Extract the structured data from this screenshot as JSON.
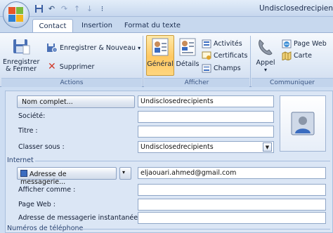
{
  "window": {
    "title": "Undisclosedrecipients"
  },
  "quick_access": {
    "icons": [
      "save-icon",
      "undo-icon",
      "redo-icon",
      "up-arrow-icon",
      "down-arrow-icon",
      "customize-icon"
    ]
  },
  "tabs": [
    {
      "label": "Contact",
      "active": true
    },
    {
      "label": "Insertion",
      "active": false
    },
    {
      "label": "Format du texte",
      "active": false
    }
  ],
  "ribbon": {
    "actions": {
      "label": "Actions",
      "save_close_line1": "Enregistrer",
      "save_close_line2": "& Fermer",
      "save_new": "Enregistrer & Nouveau",
      "save_new_caret": "▾",
      "delete": "Supprimer"
    },
    "afficher": {
      "label": "Afficher",
      "general": "Général",
      "details": "Détails",
      "activities": "Activités",
      "certificates": "Certificats",
      "fields": "Champs"
    },
    "communiquer": {
      "label": "Communiquer",
      "call": "Appel",
      "call_caret": "▾",
      "web_page": "Page Web",
      "map": "Carte"
    }
  },
  "form": {
    "full_name_button": "Nom complet...",
    "full_name_value": "Undisclosedrecipients",
    "company_label": "Société:",
    "company_value": "",
    "title_label": "Titre :",
    "title_value": "",
    "file_as_label": "Classer sous :",
    "file_as_value": "Undisclosedrecipients",
    "internet_section": "Internet",
    "email_button": "Adresse de messagerie...",
    "email_value": "eljaouari.ahmed@gmail.com",
    "display_as_label": "Afficher comme :",
    "display_as_value": "",
    "web_page_label": "Page Web :",
    "web_page_value": "",
    "im_label": "Adresse de messagerie instantanée :",
    "im_value": "",
    "phone_section": "Numéros de téléphone"
  },
  "colors": {
    "accent": "#ffc861",
    "ribbon_bg": "#dfe9f6",
    "form_bg": "#dbe6f5"
  }
}
